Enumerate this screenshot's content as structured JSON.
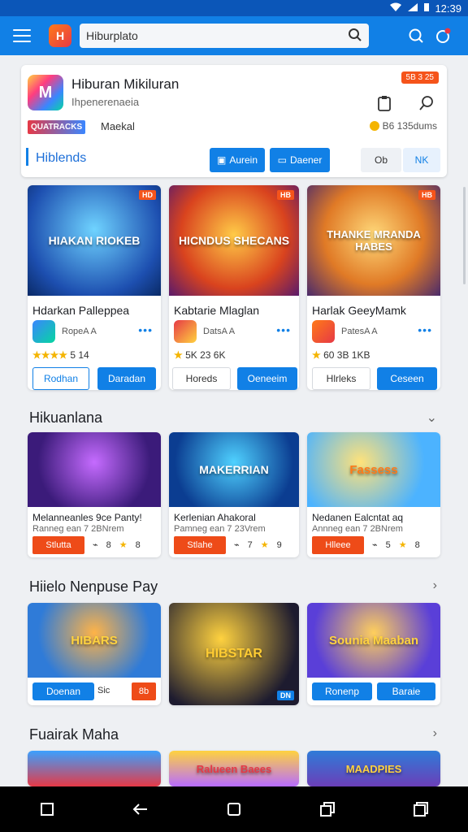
{
  "status": {
    "time": "12:39"
  },
  "topbar": {
    "search_text": "Hiburplato",
    "logo_text": "H"
  },
  "app": {
    "title": "Hiburan Mikiluran",
    "subtitle": "Ihpenerenaeia",
    "badge": "5B 3 25",
    "brand_label": "QUATRACKS",
    "brand_text": "Maekal",
    "coins": "B6 135dums",
    "section_label": "Hiblends",
    "btn_author": "Aurein",
    "btn_daener": "Daener",
    "btn_ob": "Ob",
    "btn_nk": "NK"
  },
  "featured": [
    {
      "title": "Hdarkan Palleppea",
      "image_text": "HIAKAN RIOKEB",
      "tag": "HD",
      "maker": "RopeA A",
      "rating": "5 14",
      "btn1": "Rodhan",
      "btn2": "Daradan"
    },
    {
      "title": "Kabtarie Mlaglan",
      "image_text": "HICNDUS SHECANS",
      "tag": "HB",
      "maker": "DatsA A",
      "rating": "5K 23 6K",
      "btn1": "Horeds",
      "btn2": "Oeneeim"
    },
    {
      "title": "Harlak GeeyMamk",
      "image_text": "THANKE MRANDA HABES",
      "tag": "HB",
      "maker": "PatesA A",
      "rating": "60 3B 1KB",
      "btn1": "Hlrleks",
      "btn2": "Ceseen"
    }
  ],
  "section2": {
    "title": "Hikuanlana",
    "items": [
      {
        "image_text": "",
        "line1": "Melanneanles 9ce Panty!",
        "line2": "Ranneg ean 7 2BNrem",
        "btn": "Stlutta",
        "m1": "8",
        "m2": "8"
      },
      {
        "image_text": "MAKERRIAN",
        "line1": "Kerlenian Ahakoral",
        "line2": "Pamneg ean 7 23Vrem",
        "btn": "Stlahe",
        "m1": "7",
        "m2": "9"
      },
      {
        "image_text": "Fassess",
        "line1": "Nedanen Ealcntat aq",
        "line2": "Annneg ean 7 2BNrem",
        "btn": "Hlleee",
        "m1": "5",
        "m2": "8"
      }
    ]
  },
  "section3": {
    "title": "Hiielo Nenpuse Pay",
    "items": [
      {
        "image_text": "HIBARS",
        "btn": "Doenan",
        "extra1": "Sic",
        "extra2": "8b"
      },
      {
        "image_text": "HIBSTAR",
        "tag": "DN"
      },
      {
        "image_text": "Sounia Maaban",
        "btn": "Ronenp",
        "btn2": "Baraie"
      }
    ]
  },
  "section4": {
    "title": "Fuairak Maha",
    "items": [
      {
        "image_text": ""
      },
      {
        "image_text": "Ralueen Baees"
      },
      {
        "image_text": "MAADPIES"
      }
    ]
  }
}
